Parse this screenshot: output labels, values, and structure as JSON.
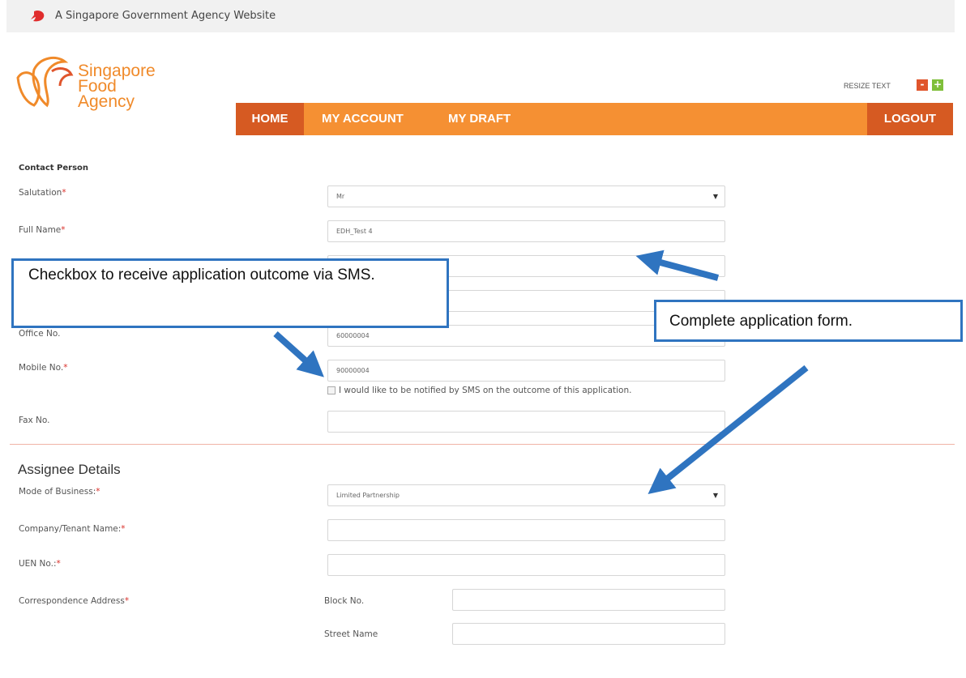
{
  "gov_bar": {
    "text": "A Singapore Government Agency Website"
  },
  "logo": {
    "line1": "Singapore",
    "line2": "Food",
    "line3": "Agency"
  },
  "resize": {
    "label": "RESIZE TEXT",
    "minus": "-",
    "plus": "+"
  },
  "nav": {
    "home": "HOME",
    "account": "MY ACCOUNT",
    "draft": "MY DRAFT",
    "logout": "LOGOUT"
  },
  "contact": {
    "heading": "Contact Person",
    "salutation_label": "Salutation",
    "salutation_value": "Mr",
    "fullname_label": "Full Name",
    "fullname_value": "EDH_Test 4",
    "office_label": "Office No.",
    "office_value": "60000004",
    "mobile_label": "Mobile No.",
    "mobile_value": "90000004",
    "sms_checkbox_label": "I would like to be notified by SMS on the outcome of this application.",
    "fax_label": "Fax No."
  },
  "assignee": {
    "heading": "Assignee Details",
    "mode_label": "Mode of Business:",
    "mode_value": "Limited Partnership",
    "company_label": "Company/Tenant Name:",
    "uen_label": "UEN No.:",
    "address_label": "Correspondence Address",
    "block_label": "Block No.",
    "street_label": "Street Name"
  },
  "required_marker": "*",
  "callouts": {
    "sms": "Checkbox to receive application outcome via SMS.",
    "form": "Complete application form."
  },
  "colors": {
    "brand_orange": "#f59033",
    "nav_active": "#d65a22",
    "callout_blue": "#2f74c0"
  }
}
